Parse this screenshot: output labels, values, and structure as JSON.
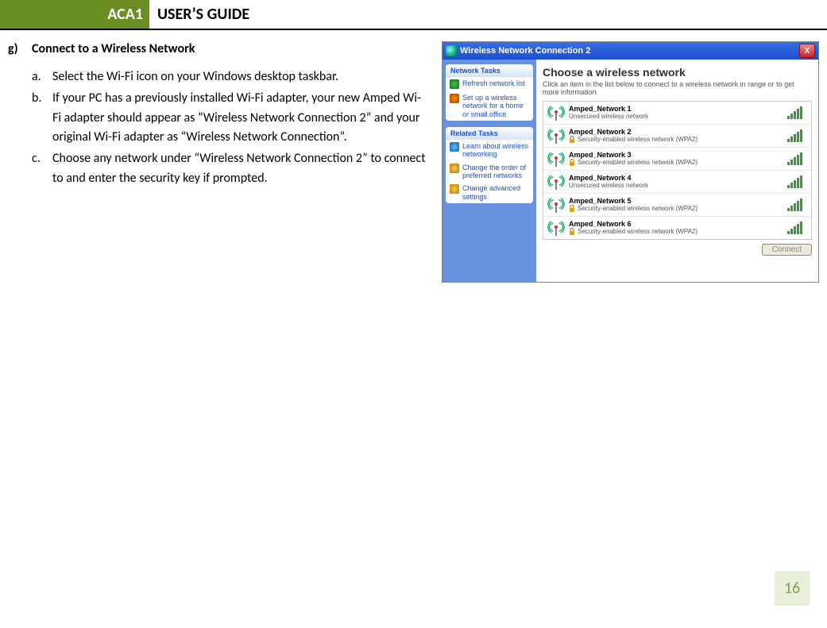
{
  "header": {
    "left": "ACA1",
    "right": "USER’S GUIDE"
  },
  "section": {
    "marker": "g)",
    "title": "Connect to a Wireless  Network"
  },
  "steps": [
    {
      "m": "a.",
      "t": "Select the Wi-Fi icon on your Windows desktop taskbar."
    },
    {
      "m": "b.",
      "t": "If your PC has a previously installed Wi-Fi adapter, your new Amped Wi-Fi adapter should appear as “Wireless Network Connection 2” and your original Wi-Fi adapter as “Wireless Network Connection”."
    },
    {
      "m": "c.",
      "t": "Choose any network under “Wireless Network Connection 2” to connect to and enter the security key if prompted."
    }
  ],
  "xp": {
    "title": "Wireless Network Connection 2",
    "close": "X",
    "side": {
      "tasks_hdr": "Network Tasks",
      "task_refresh": "Refresh network list",
      "task_setup": "Set up a wireless network for a home or small office",
      "related_hdr": "Related Tasks",
      "rel_learn": "Learn about wireless networking",
      "rel_order": "Change the order of preferred networks",
      "rel_adv": "Change advanced settings"
    },
    "main": {
      "title": "Choose a wireless network",
      "sub": "Click an item in the list below to connect to a wireless network in range or to get more information.",
      "connect": "Connect",
      "unsecured": "Unsecured wireless network",
      "secured": "Security-enabled wireless network (WPA2)",
      "nets": [
        {
          "name": "Amped_Network 1",
          "secure": false
        },
        {
          "name": "Amped_Network 2",
          "secure": true
        },
        {
          "name": "Amped_Network 3",
          "secure": true
        },
        {
          "name": "Amped_Network 4",
          "secure": false
        },
        {
          "name": "Amped_Network 5",
          "secure": true
        },
        {
          "name": "Amped_Network 6",
          "secure": true
        }
      ]
    }
  },
  "page_number": "16"
}
